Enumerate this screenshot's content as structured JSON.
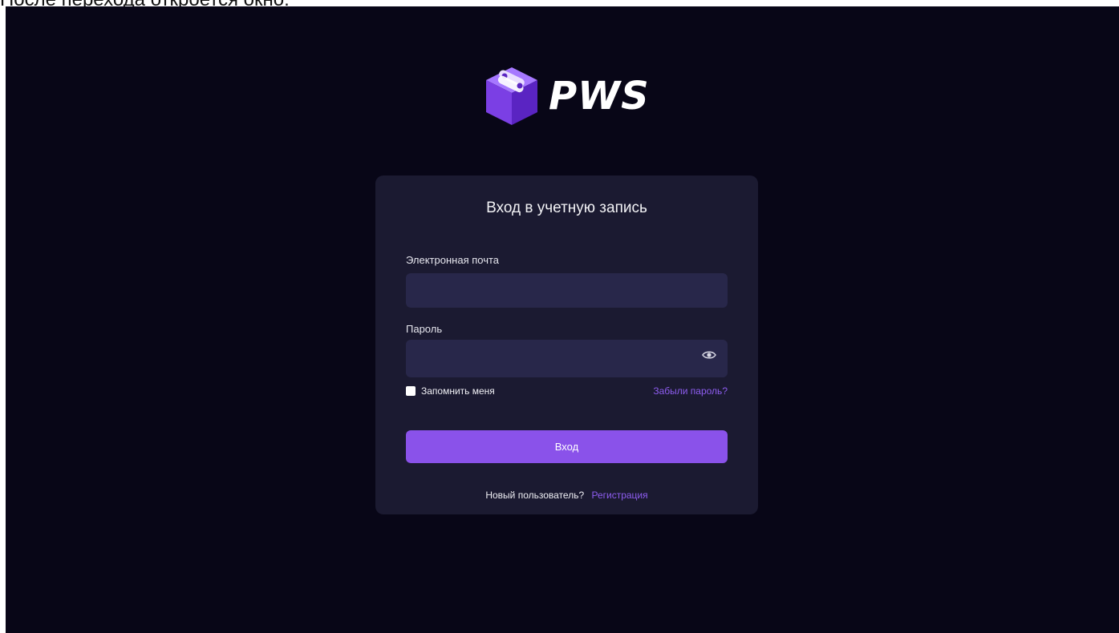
{
  "caption": "После перехода откроется окно:",
  "logo": {
    "text": "PWS",
    "icon": "cube-logo-icon"
  },
  "form": {
    "title": "Вход в учетную запись",
    "email_label": "Электронная почта",
    "email_value": "",
    "password_label": "Пароль",
    "password_value": "",
    "remember_label": "Запомнить меня",
    "forgot_link": "Забыли пароль?",
    "submit_label": "Вход",
    "new_user_text": "Новый пользователь?",
    "register_link": "Регистрация"
  },
  "colors": {
    "background": "#080617",
    "card": "#1b1a31",
    "input": "#28274a",
    "accent": "#8a52ea",
    "link": "#8e5df0"
  }
}
